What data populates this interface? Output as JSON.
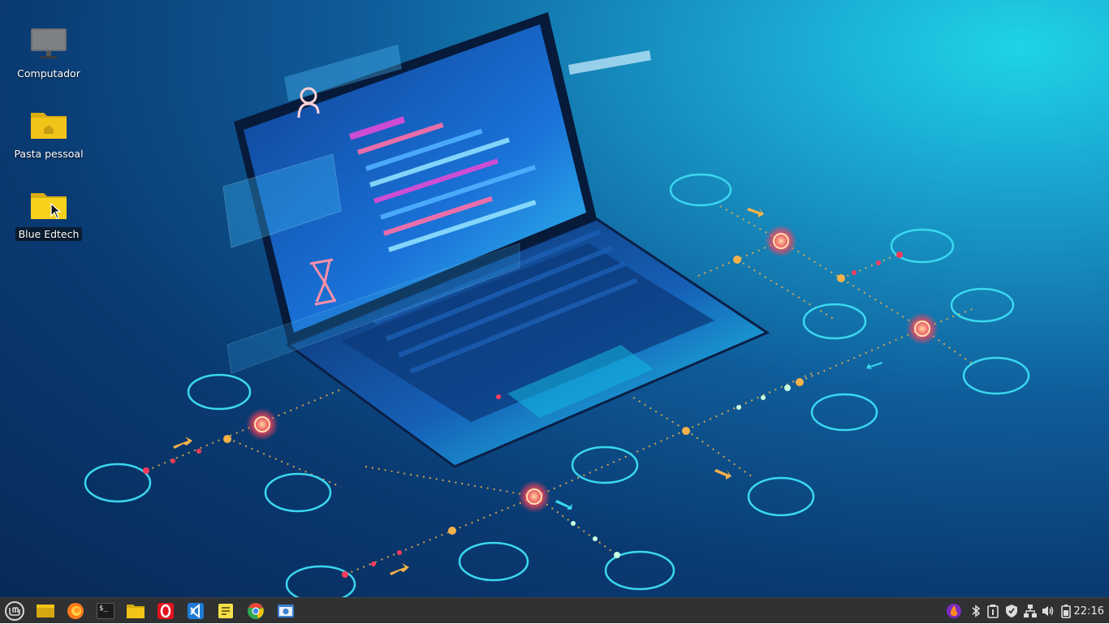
{
  "desktop": {
    "icons": [
      {
        "label": "Computador",
        "icon": "monitor-icon"
      },
      {
        "label": "Pasta pessoal",
        "icon": "home-folder-icon"
      },
      {
        "label": "Blue Edtech",
        "icon": "folder-icon",
        "selected": true
      }
    ]
  },
  "taskbar": {
    "launchers": [
      {
        "name": "menu",
        "icon": "linux-mint-menu-icon"
      },
      {
        "name": "show-desktop",
        "icon": "show-desktop-icon"
      },
      {
        "name": "firefox",
        "icon": "firefox-icon"
      },
      {
        "name": "terminal",
        "icon": "terminal-icon",
        "glyph": "$_"
      },
      {
        "name": "files",
        "icon": "file-manager-icon"
      },
      {
        "name": "opera",
        "icon": "opera-icon"
      },
      {
        "name": "vscode",
        "icon": "vscode-icon"
      },
      {
        "name": "notes",
        "icon": "sticky-notes-icon"
      },
      {
        "name": "chrome",
        "icon": "chrome-icon"
      },
      {
        "name": "screenshot",
        "icon": "screenshot-icon"
      }
    ],
    "tray": [
      "flame-app-icon",
      "bluetooth-icon",
      "clipboard-info-icon",
      "shield-icon",
      "network-icon",
      "volume-icon",
      "battery-icon"
    ],
    "clock": "22:16"
  },
  "colors": {
    "panel": "#2f3133",
    "folder_yellow": "#f2c417",
    "accent_cyan": "#3ad8f0",
    "node_red": "#ff3b5c",
    "node_orange": "#f6b04a"
  }
}
